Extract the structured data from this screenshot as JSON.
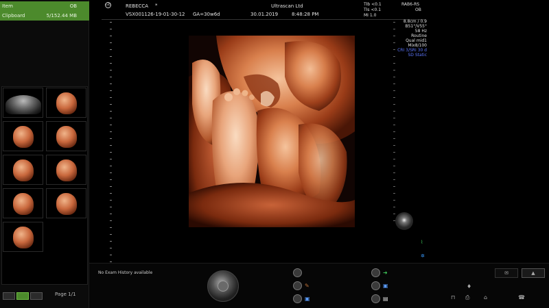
{
  "sidebar": {
    "rows": [
      {
        "left": "Item",
        "right": "OB"
      },
      {
        "left": "Clipboard",
        "right": "5/152.44 MB"
      }
    ],
    "page_indicator": "Page 1/1"
  },
  "header": {
    "logo_text": "GE",
    "patient_name": "REBECCA",
    "patient_mark": "*",
    "exam_id": "VSX001126-19-01-30-12",
    "ga": "GA=30w6d",
    "institution": "Ultrascan Ltd",
    "date": "30.01.2019",
    "time": "8:48:28 PM",
    "tib": "TIb <0.1",
    "tis": "TIs <0.1",
    "mi": "MI  1.0",
    "probe": "RAB6-RS",
    "app": "OB"
  },
  "params": [
    {
      "text": "8.8cm / 0.9",
      "color": "#e2e2e2"
    },
    {
      "text": "B51°/V55°",
      "color": "#e2e2e2"
    },
    {
      "text": "58 Hz",
      "color": "#e2e2e2"
    },
    {
      "text": "Routine",
      "color": "#e2e2e2"
    },
    {
      "text": "Qual mid1",
      "color": "#e2e2e2"
    },
    {
      "text": "Mix8/100",
      "color": "#e2e2e2"
    },
    {
      "text": "CRI 3/SRI 30 d",
      "color": "#5e78ff"
    },
    {
      "text": "SD Static",
      "color": "#5e78ff"
    }
  ],
  "footer": {
    "exam_history": "No Exam History available"
  },
  "tabs": [
    {
      "icon": "report-icon"
    },
    {
      "icon": "probe-icon"
    }
  ],
  "colors": {
    "accent_green": "#4c8a2c",
    "param_blue": "#5e78ff",
    "render_orange": "#c9683d"
  }
}
